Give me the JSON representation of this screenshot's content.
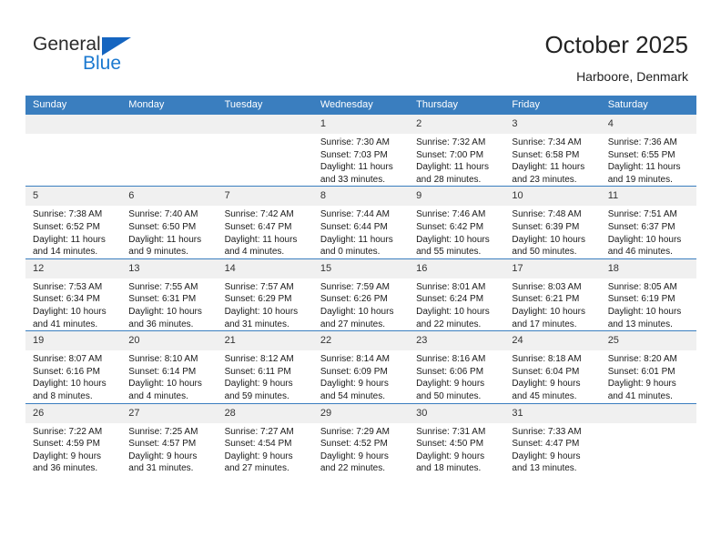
{
  "brand": {
    "name_top": "General",
    "name_bottom": "Blue",
    "color_dark": "#2b2b2b",
    "color_blue": "#1b79d0",
    "triangle_color": "#1565c0"
  },
  "header": {
    "title": "October 2025",
    "subtitle": "Harboore, Denmark"
  },
  "theme": {
    "header_row_bg": "#3a7ebf",
    "header_row_text": "#ffffff",
    "daynum_bg": "#f0f0f0",
    "cell_bg": "#ffffff",
    "row_divider": "#3a7ebf"
  },
  "calendar": {
    "weekday_headers": [
      "Sunday",
      "Monday",
      "Tuesday",
      "Wednesday",
      "Thursday",
      "Friday",
      "Saturday"
    ],
    "weeks": [
      [
        {
          "day": "",
          "empty": true
        },
        {
          "day": "",
          "empty": true
        },
        {
          "day": "",
          "empty": true
        },
        {
          "day": "1",
          "sunrise": "Sunrise: 7:30 AM",
          "sunset": "Sunset: 7:03 PM",
          "daylight": "Daylight: 11 hours and 33 minutes."
        },
        {
          "day": "2",
          "sunrise": "Sunrise: 7:32 AM",
          "sunset": "Sunset: 7:00 PM",
          "daylight": "Daylight: 11 hours and 28 minutes."
        },
        {
          "day": "3",
          "sunrise": "Sunrise: 7:34 AM",
          "sunset": "Sunset: 6:58 PM",
          "daylight": "Daylight: 11 hours and 23 minutes."
        },
        {
          "day": "4",
          "sunrise": "Sunrise: 7:36 AM",
          "sunset": "Sunset: 6:55 PM",
          "daylight": "Daylight: 11 hours and 19 minutes."
        }
      ],
      [
        {
          "day": "5",
          "sunrise": "Sunrise: 7:38 AM",
          "sunset": "Sunset: 6:52 PM",
          "daylight": "Daylight: 11 hours and 14 minutes."
        },
        {
          "day": "6",
          "sunrise": "Sunrise: 7:40 AM",
          "sunset": "Sunset: 6:50 PM",
          "daylight": "Daylight: 11 hours and 9 minutes."
        },
        {
          "day": "7",
          "sunrise": "Sunrise: 7:42 AM",
          "sunset": "Sunset: 6:47 PM",
          "daylight": "Daylight: 11 hours and 4 minutes."
        },
        {
          "day": "8",
          "sunrise": "Sunrise: 7:44 AM",
          "sunset": "Sunset: 6:44 PM",
          "daylight": "Daylight: 11 hours and 0 minutes."
        },
        {
          "day": "9",
          "sunrise": "Sunrise: 7:46 AM",
          "sunset": "Sunset: 6:42 PM",
          "daylight": "Daylight: 10 hours and 55 minutes."
        },
        {
          "day": "10",
          "sunrise": "Sunrise: 7:48 AM",
          "sunset": "Sunset: 6:39 PM",
          "daylight": "Daylight: 10 hours and 50 minutes."
        },
        {
          "day": "11",
          "sunrise": "Sunrise: 7:51 AM",
          "sunset": "Sunset: 6:37 PM",
          "daylight": "Daylight: 10 hours and 46 minutes."
        }
      ],
      [
        {
          "day": "12",
          "sunrise": "Sunrise: 7:53 AM",
          "sunset": "Sunset: 6:34 PM",
          "daylight": "Daylight: 10 hours and 41 minutes."
        },
        {
          "day": "13",
          "sunrise": "Sunrise: 7:55 AM",
          "sunset": "Sunset: 6:31 PM",
          "daylight": "Daylight: 10 hours and 36 minutes."
        },
        {
          "day": "14",
          "sunrise": "Sunrise: 7:57 AM",
          "sunset": "Sunset: 6:29 PM",
          "daylight": "Daylight: 10 hours and 31 minutes."
        },
        {
          "day": "15",
          "sunrise": "Sunrise: 7:59 AM",
          "sunset": "Sunset: 6:26 PM",
          "daylight": "Daylight: 10 hours and 27 minutes."
        },
        {
          "day": "16",
          "sunrise": "Sunrise: 8:01 AM",
          "sunset": "Sunset: 6:24 PM",
          "daylight": "Daylight: 10 hours and 22 minutes."
        },
        {
          "day": "17",
          "sunrise": "Sunrise: 8:03 AM",
          "sunset": "Sunset: 6:21 PM",
          "daylight": "Daylight: 10 hours and 17 minutes."
        },
        {
          "day": "18",
          "sunrise": "Sunrise: 8:05 AM",
          "sunset": "Sunset: 6:19 PM",
          "daylight": "Daylight: 10 hours and 13 minutes."
        }
      ],
      [
        {
          "day": "19",
          "sunrise": "Sunrise: 8:07 AM",
          "sunset": "Sunset: 6:16 PM",
          "daylight": "Daylight: 10 hours and 8 minutes."
        },
        {
          "day": "20",
          "sunrise": "Sunrise: 8:10 AM",
          "sunset": "Sunset: 6:14 PM",
          "daylight": "Daylight: 10 hours and 4 minutes."
        },
        {
          "day": "21",
          "sunrise": "Sunrise: 8:12 AM",
          "sunset": "Sunset: 6:11 PM",
          "daylight": "Daylight: 9 hours and 59 minutes."
        },
        {
          "day": "22",
          "sunrise": "Sunrise: 8:14 AM",
          "sunset": "Sunset: 6:09 PM",
          "daylight": "Daylight: 9 hours and 54 minutes."
        },
        {
          "day": "23",
          "sunrise": "Sunrise: 8:16 AM",
          "sunset": "Sunset: 6:06 PM",
          "daylight": "Daylight: 9 hours and 50 minutes."
        },
        {
          "day": "24",
          "sunrise": "Sunrise: 8:18 AM",
          "sunset": "Sunset: 6:04 PM",
          "daylight": "Daylight: 9 hours and 45 minutes."
        },
        {
          "day": "25",
          "sunrise": "Sunrise: 8:20 AM",
          "sunset": "Sunset: 6:01 PM",
          "daylight": "Daylight: 9 hours and 41 minutes."
        }
      ],
      [
        {
          "day": "26",
          "sunrise": "Sunrise: 7:22 AM",
          "sunset": "Sunset: 4:59 PM",
          "daylight": "Daylight: 9 hours and 36 minutes."
        },
        {
          "day": "27",
          "sunrise": "Sunrise: 7:25 AM",
          "sunset": "Sunset: 4:57 PM",
          "daylight": "Daylight: 9 hours and 31 minutes."
        },
        {
          "day": "28",
          "sunrise": "Sunrise: 7:27 AM",
          "sunset": "Sunset: 4:54 PM",
          "daylight": "Daylight: 9 hours and 27 minutes."
        },
        {
          "day": "29",
          "sunrise": "Sunrise: 7:29 AM",
          "sunset": "Sunset: 4:52 PM",
          "daylight": "Daylight: 9 hours and 22 minutes."
        },
        {
          "day": "30",
          "sunrise": "Sunrise: 7:31 AM",
          "sunset": "Sunset: 4:50 PM",
          "daylight": "Daylight: 9 hours and 18 minutes."
        },
        {
          "day": "31",
          "sunrise": "Sunrise: 7:33 AM",
          "sunset": "Sunset: 4:47 PM",
          "daylight": "Daylight: 9 hours and 13 minutes."
        },
        {
          "day": "",
          "empty": true
        }
      ]
    ]
  }
}
